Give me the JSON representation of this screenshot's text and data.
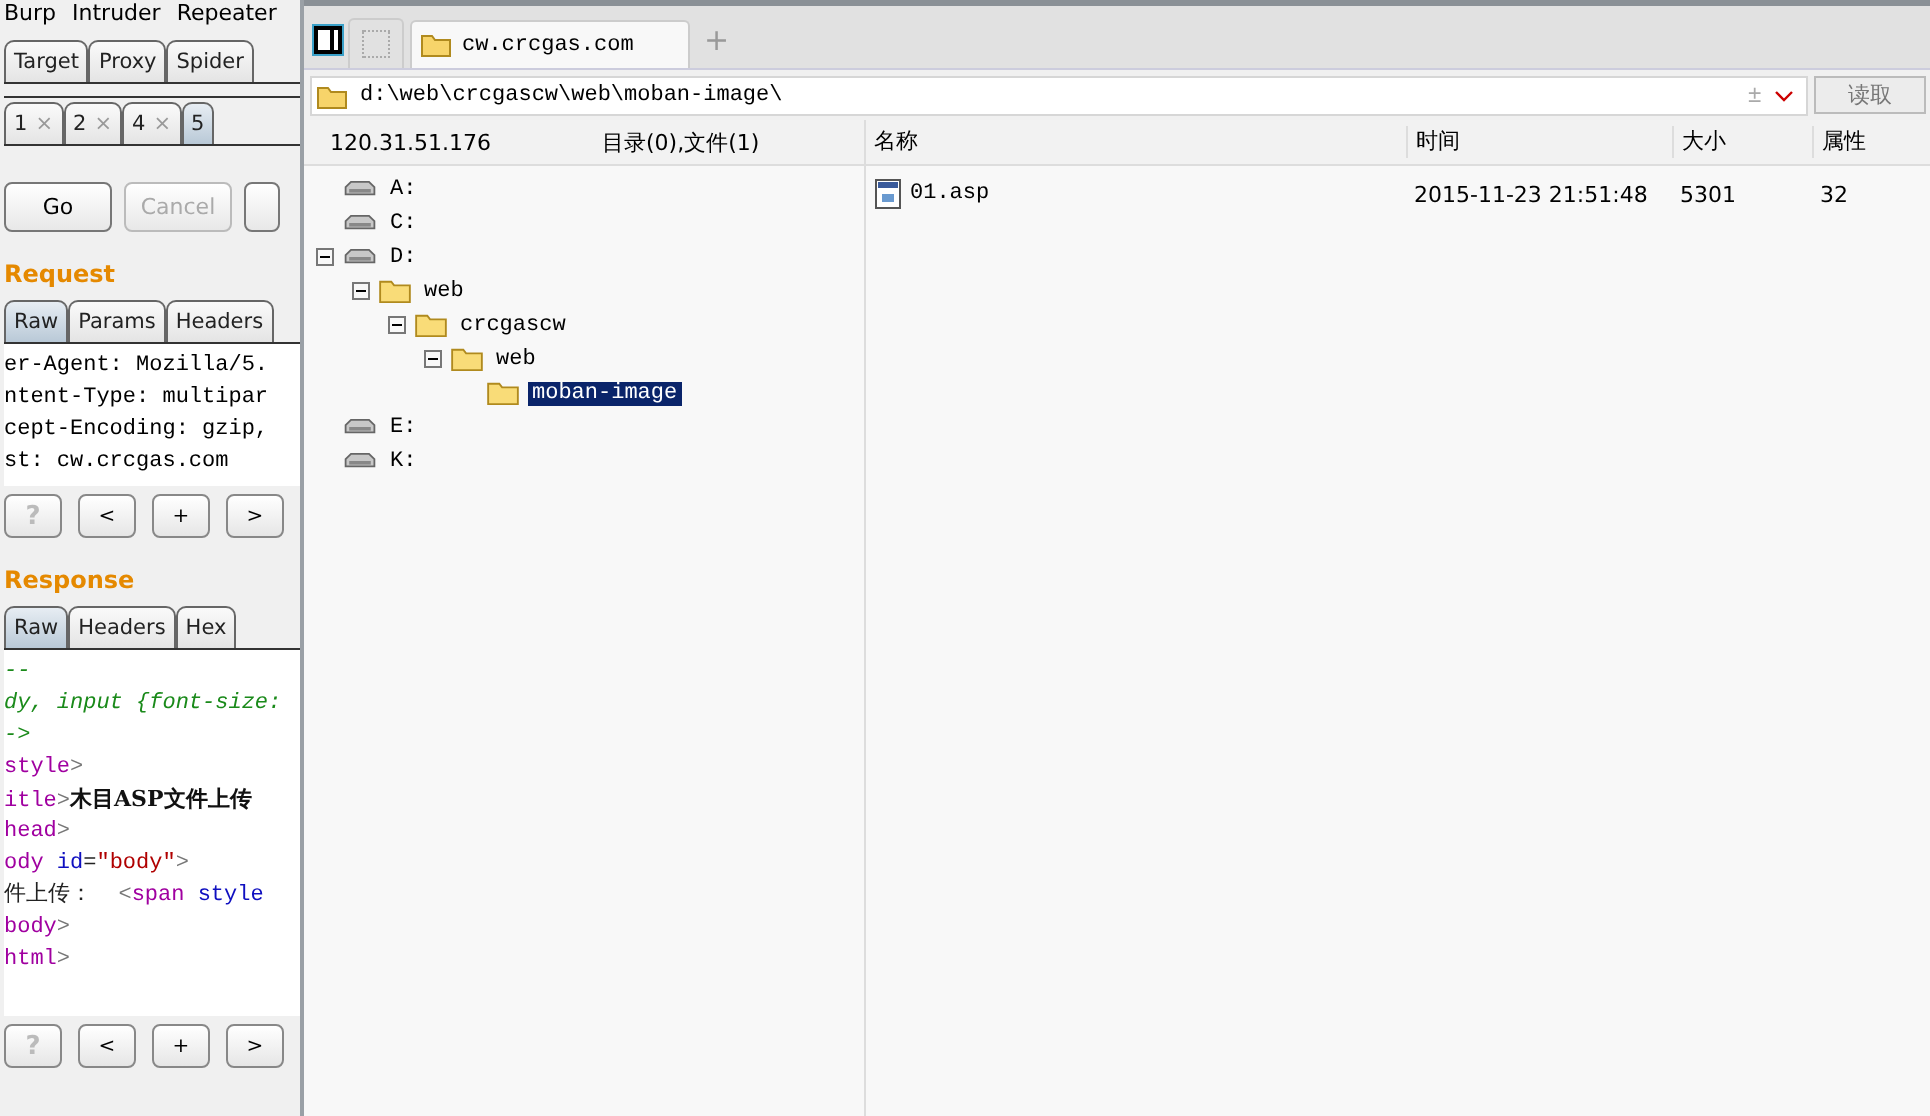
{
  "burp": {
    "menu": [
      "Burp",
      "Intruder",
      "Repeater"
    ],
    "tool_tabs": [
      {
        "label": "Target",
        "selected": false
      },
      {
        "label": "Proxy",
        "selected": false
      },
      {
        "label": "Spider",
        "selected": false
      }
    ],
    "repeater_tabs": [
      {
        "label": "1",
        "close": "×",
        "selected": false
      },
      {
        "label": "2",
        "close": "×",
        "selected": false
      },
      {
        "label": "4",
        "close": "×",
        "selected": false
      },
      {
        "label": "5",
        "selected": true
      }
    ],
    "actions": [
      {
        "label": "Go",
        "disabled": false
      },
      {
        "label": "Cancel",
        "disabled": true
      }
    ],
    "request": {
      "title": "Request",
      "tabs": [
        {
          "label": "Raw",
          "selected": true
        },
        {
          "label": "Params",
          "selected": false
        },
        {
          "label": "Headers",
          "selected": false
        }
      ],
      "lines": [
        "er-Agent: Mozilla/5.",
        "ntent-Type: multipar",
        "cept-Encoding: gzip,",
        "st: cw.crcgas.com"
      ],
      "nav": [
        {
          "label": "?",
          "disabled": true
        },
        {
          "label": "<",
          "disabled": false
        },
        {
          "label": "+",
          "disabled": false
        },
        {
          "label": ">",
          "disabled": false
        }
      ]
    },
    "response": {
      "title": "Response",
      "tabs": [
        {
          "label": "Raw",
          "selected": true
        },
        {
          "label": "Headers",
          "selected": false
        },
        {
          "label": "Hex",
          "selected": false
        }
      ],
      "lines": [
        [
          {
            "text": "--",
            "kind": "css"
          }
        ],
        [
          {
            "text": "dy, input {font-size:",
            "kind": "css"
          }
        ],
        [
          {
            "text": "->",
            "kind": "css"
          }
        ],
        [
          {
            "text": "style",
            "kind": "tag"
          },
          {
            "text": ">",
            "kind": "punct"
          }
        ],
        [
          {
            "text": "itle",
            "kind": "tag"
          },
          {
            "text": ">",
            "kind": "punct"
          },
          {
            "text": "木目ASP文件上传",
            "kind": "title"
          }
        ],
        [
          {
            "text": "head",
            "kind": "tag"
          },
          {
            "text": ">",
            "kind": "punct"
          }
        ],
        [
          {
            "text": "ody ",
            "kind": "tag"
          },
          {
            "text": "id",
            "kind": "attr"
          },
          {
            "text": "=",
            "kind": "text"
          },
          {
            "text": "\"body\"",
            "kind": "string"
          },
          {
            "text": ">",
            "kind": "punct"
          }
        ],
        [
          {
            "text": "件上传：  ",
            "kind": "text"
          },
          {
            "text": "<",
            "kind": "punct"
          },
          {
            "text": "span ",
            "kind": "tag"
          },
          {
            "text": "style",
            "kind": "attr"
          }
        ],
        [
          {
            "text": "body",
            "kind": "tag"
          },
          {
            "text": ">",
            "kind": "punct"
          }
        ],
        [
          {
            "text": "html",
            "kind": "tag"
          },
          {
            "text": ">",
            "kind": "punct"
          }
        ]
      ],
      "nav": [
        {
          "label": "?",
          "disabled": true
        },
        {
          "label": "<",
          "disabled": false
        },
        {
          "label": "+",
          "disabled": false
        },
        {
          "label": ">",
          "disabled": false
        }
      ]
    }
  },
  "browser": {
    "tabs": [
      {
        "label": "cw.crcgas.com",
        "selected": true
      }
    ],
    "new_tab": "+",
    "path": "d:\\web\\crcgascw\\web\\moban-image\\",
    "path_plus": "±",
    "read_button": "读取",
    "host": "120.31.51.176",
    "summary": "目录(0),文件(1)",
    "tree": [
      {
        "label": "A:",
        "kind": "drive",
        "selected": false
      },
      {
        "label": "C:",
        "kind": "drive",
        "selected": false
      },
      {
        "label": "D:",
        "kind": "drive",
        "selected": false,
        "expanded": true,
        "children": [
          {
            "label": "web",
            "kind": "folder",
            "selected": false,
            "expanded": true,
            "children": [
              {
                "label": "crcgascw",
                "kind": "folder",
                "selected": false,
                "expanded": true,
                "children": [
                  {
                    "label": "web",
                    "kind": "folder",
                    "selected": false,
                    "expanded": true,
                    "children": [
                      {
                        "label": "moban-image",
                        "kind": "folder",
                        "selected": true
                      }
                    ]
                  }
                ]
              }
            ]
          }
        ]
      },
      {
        "label": "E:",
        "kind": "drive",
        "selected": false
      },
      {
        "label": "K:",
        "kind": "drive",
        "selected": false
      }
    ],
    "columns": [
      "名称",
      "时间",
      "大小",
      "属性"
    ],
    "files": [
      {
        "name": "01.asp",
        "time": "2015-11-23 21:51:48",
        "size": "5301",
        "attr": "32"
      }
    ]
  }
}
